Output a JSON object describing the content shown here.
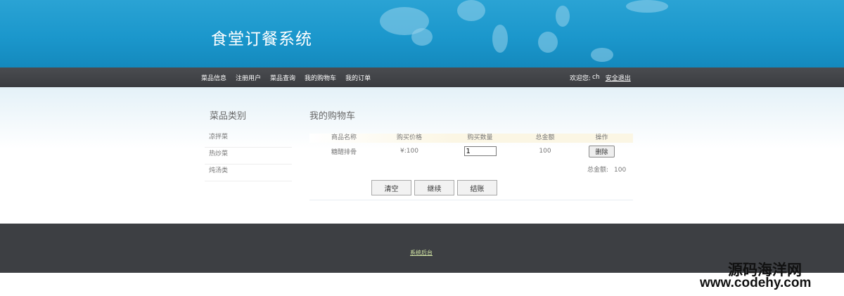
{
  "header": {
    "title": "食堂订餐系统"
  },
  "nav": {
    "links": [
      "菜品信息",
      "注册用户",
      "菜品查询",
      "我的购物车",
      "我的订单"
    ],
    "welcome": "欢迎您:",
    "user": "ch",
    "logout": "安全退出"
  },
  "sidebar": {
    "title": "菜品类别",
    "items": [
      "凉拌菜",
      "热炒菜",
      "炖汤类"
    ]
  },
  "cart": {
    "title": "我的购物车",
    "columns": [
      "商品名称",
      "购买价格",
      "购买数量",
      "总金额",
      "操作"
    ],
    "rows": [
      {
        "name": "糖醋排骨",
        "price": "¥:100",
        "quantity": "1",
        "total": "100",
        "action": "删除"
      }
    ],
    "total_label": "总金额:",
    "total_value": "100",
    "buttons": {
      "clear": "清空",
      "continue": "继续",
      "checkout": "结账"
    }
  },
  "footer": {
    "link": "系统后台"
  },
  "watermark": {
    "cn": "源码海洋网",
    "url": "www.codehy.com"
  },
  "colors": {
    "header_blue": "#1b97cc",
    "nav_dark": "#3a3c40",
    "footer_dark": "#3d3f43"
  }
}
